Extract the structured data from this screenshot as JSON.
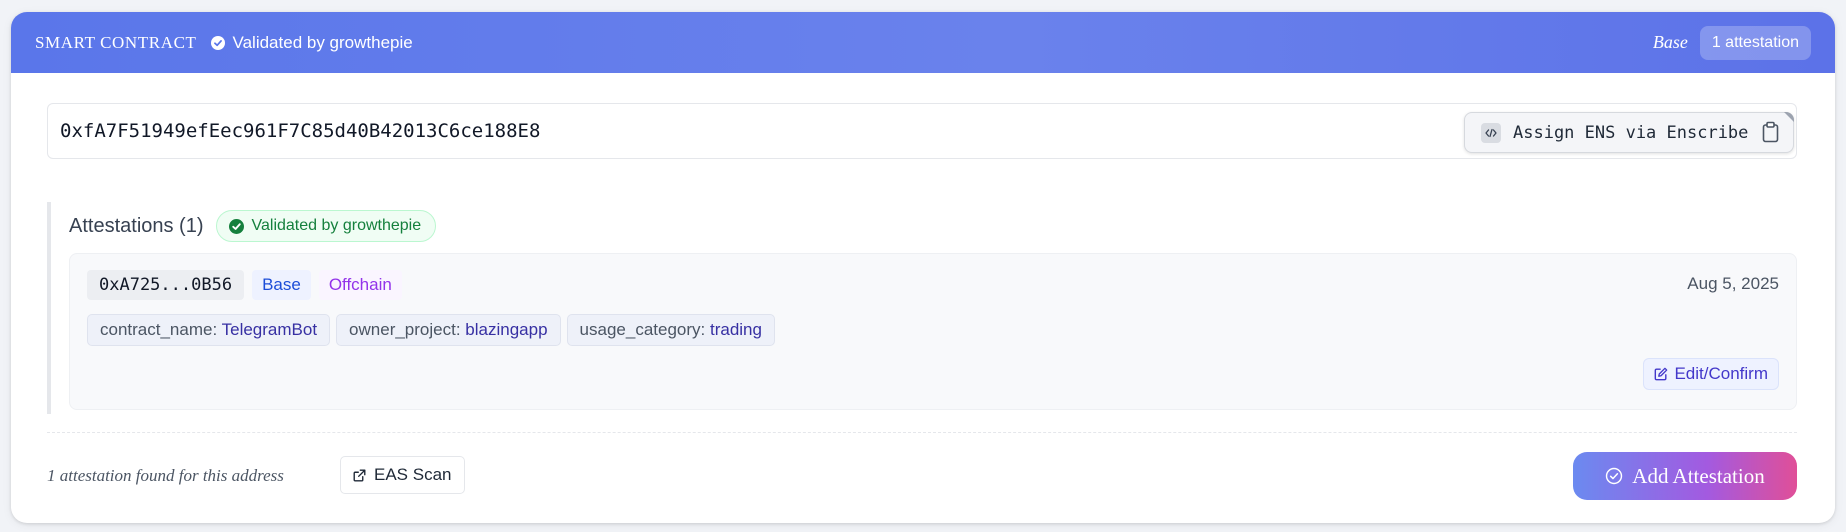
{
  "header": {
    "title": "SMART CONTRACT",
    "validated_label": "Validated by growthepie",
    "network": "Base",
    "attestation_count_label": "1 attestation",
    "gradient_colors": [
      "#5a76ea",
      "#6a82ec"
    ]
  },
  "address": {
    "value": "0xfA7F51949efEec961F7C85d40B42013C6ce188E8",
    "ens_button_label": "Assign ENS via Enscribe",
    "copy_icon": "clipboard-icon"
  },
  "attestations": {
    "title": "Attestations (1)",
    "validated_badge": "Validated by growthepie",
    "items": [
      {
        "id": "0xA725...0B56",
        "network_chip": "Base",
        "type_chip": "Offchain",
        "date": "Aug 5, 2025",
        "tags": [
          {
            "key": "contract_name:",
            "value": "TelegramBot"
          },
          {
            "key": "owner_project:",
            "value": "blazingapp"
          },
          {
            "key": "usage_category:",
            "value": "trading"
          }
        ],
        "edit_label": "Edit/Confirm"
      }
    ]
  },
  "footer": {
    "found_text": "1 attestation found for this address",
    "eas_label": "EAS Scan",
    "add_label": "Add Attestation",
    "add_gradient": [
      "#6b8af0",
      "#a35ae0",
      "#e04f98"
    ]
  }
}
